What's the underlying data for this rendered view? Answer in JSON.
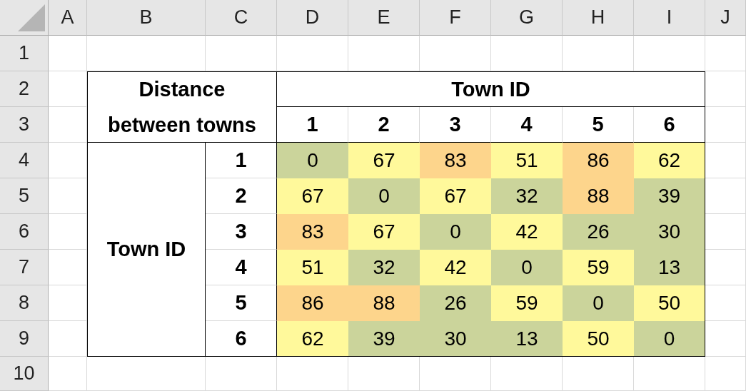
{
  "column_headers": [
    "A",
    "B",
    "C",
    "D",
    "E",
    "F",
    "G",
    "H",
    "I",
    "J"
  ],
  "row_headers": [
    "1",
    "2",
    "3",
    "4",
    "5",
    "6",
    "7",
    "8",
    "9",
    "10"
  ],
  "table": {
    "title": "Distance between towns",
    "column_group": "Town ID",
    "column_ids": [
      "1",
      "2",
      "3",
      "4",
      "5",
      "6"
    ],
    "row_group": "Town ID",
    "rows": [
      {
        "id": "1",
        "cells": [
          {
            "value": "0",
            "color": "#cbd49b"
          },
          {
            "value": "67",
            "color": "#fff99b"
          },
          {
            "value": "83",
            "color": "#fdd58c"
          },
          {
            "value": "51",
            "color": "#fff99b"
          },
          {
            "value": "86",
            "color": "#fdd58c"
          },
          {
            "value": "62",
            "color": "#fff99b"
          }
        ]
      },
      {
        "id": "2",
        "cells": [
          {
            "value": "67",
            "color": "#fff99b"
          },
          {
            "value": "0",
            "color": "#cbd49b"
          },
          {
            "value": "67",
            "color": "#fff99b"
          },
          {
            "value": "32",
            "color": "#cbd49b"
          },
          {
            "value": "88",
            "color": "#fdd58c"
          },
          {
            "value": "39",
            "color": "#cbd49b"
          }
        ]
      },
      {
        "id": "3",
        "cells": [
          {
            "value": "83",
            "color": "#fdd58c"
          },
          {
            "value": "67",
            "color": "#fff99b"
          },
          {
            "value": "0",
            "color": "#cbd49b"
          },
          {
            "value": "42",
            "color": "#fff99b"
          },
          {
            "value": "26",
            "color": "#cbd49b"
          },
          {
            "value": "30",
            "color": "#cbd49b"
          }
        ]
      },
      {
        "id": "4",
        "cells": [
          {
            "value": "51",
            "color": "#fff99b"
          },
          {
            "value": "32",
            "color": "#cbd49b"
          },
          {
            "value": "42",
            "color": "#fff99b"
          },
          {
            "value": "0",
            "color": "#cbd49b"
          },
          {
            "value": "59",
            "color": "#fff99b"
          },
          {
            "value": "13",
            "color": "#cbd49b"
          }
        ]
      },
      {
        "id": "5",
        "cells": [
          {
            "value": "86",
            "color": "#fdd58c"
          },
          {
            "value": "88",
            "color": "#fdd58c"
          },
          {
            "value": "26",
            "color": "#cbd49b"
          },
          {
            "value": "59",
            "color": "#fff99b"
          },
          {
            "value": "0",
            "color": "#cbd49b"
          },
          {
            "value": "50",
            "color": "#fff99b"
          }
        ]
      },
      {
        "id": "6",
        "cells": [
          {
            "value": "62",
            "color": "#fff99b"
          },
          {
            "value": "39",
            "color": "#cbd49b"
          },
          {
            "value": "30",
            "color": "#cbd49b"
          },
          {
            "value": "13",
            "color": "#cbd49b"
          },
          {
            "value": "50",
            "color": "#fff99b"
          },
          {
            "value": "0",
            "color": "#cbd49b"
          }
        ]
      }
    ]
  }
}
